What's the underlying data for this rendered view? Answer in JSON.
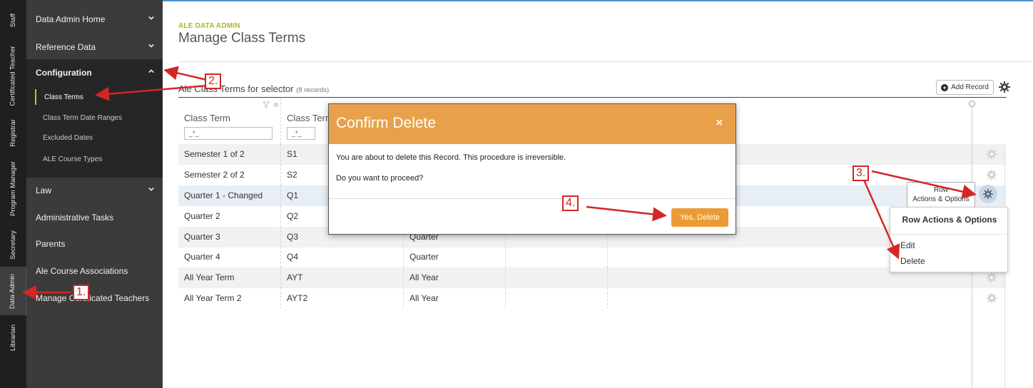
{
  "vertical_tabs": [
    "Staff",
    "Certificated Teacher",
    "Registrar",
    "Program Manager",
    "Secretary",
    "Data Admin",
    "Librarian"
  ],
  "sidebar": {
    "data_admin_home": "Data Admin Home",
    "reference_data": "Reference Data",
    "configuration": "Configuration",
    "config_items": [
      "Class Terms",
      "Class Term Date Ranges",
      "Excluded Dates",
      "ALE Course Types"
    ],
    "law": "Law",
    "administrative_tasks": "Administrative Tasks",
    "parents": "Parents",
    "ale_course_associations": "Ale Course Associations",
    "manage_certificated_teachers": "Manage Certificated Teachers"
  },
  "page": {
    "eyebrow": "ALE DATA ADMIN",
    "title": "Manage Class Terms",
    "grid_title": "Ale Class Terms for selector",
    "grid_count": "(8 records)",
    "add_record": "Add Record"
  },
  "table": {
    "columns": [
      "Class Term",
      "Class Term"
    ],
    "filter_placeholder": "_*_",
    "rows": [
      {
        "name": "Semester 1 of 2",
        "code": "S1",
        "type": ""
      },
      {
        "name": "Semester 2 of 2",
        "code": "S2",
        "type": ""
      },
      {
        "name": "Quarter 1 - Changed",
        "code": "Q1",
        "type": ""
      },
      {
        "name": "Quarter 2",
        "code": "Q2",
        "type": ""
      },
      {
        "name": "Quarter 3",
        "code": "Q3",
        "type": "Quarter"
      },
      {
        "name": "Quarter 4",
        "code": "Q4",
        "type": "Quarter"
      },
      {
        "name": "All Year Term",
        "code": "AYT",
        "type": "All Year"
      },
      {
        "name": "All Year Term 2",
        "code": "AYT2",
        "type": "All Year"
      }
    ]
  },
  "row_actions": {
    "tooltip_line1": "Row",
    "tooltip_line2": "Actions & Options",
    "menu_title": "Row Actions & Options",
    "edit": "Edit",
    "delete": "Delete"
  },
  "modal": {
    "title": "Confirm Delete",
    "close": "×",
    "message": "You are about to delete this Record. This procedure is irreversible.",
    "question": "Do you want to proceed?",
    "confirm": "Yes, Delete"
  },
  "callouts": [
    "1.",
    "2.",
    "3.",
    "4."
  ],
  "colors": {
    "modal_header": "#e8a14a",
    "confirm_button": "#eb9b34",
    "eyebrow": "#b1b321",
    "annotation": "#d32626",
    "sidebar": "#3b3b3b"
  }
}
